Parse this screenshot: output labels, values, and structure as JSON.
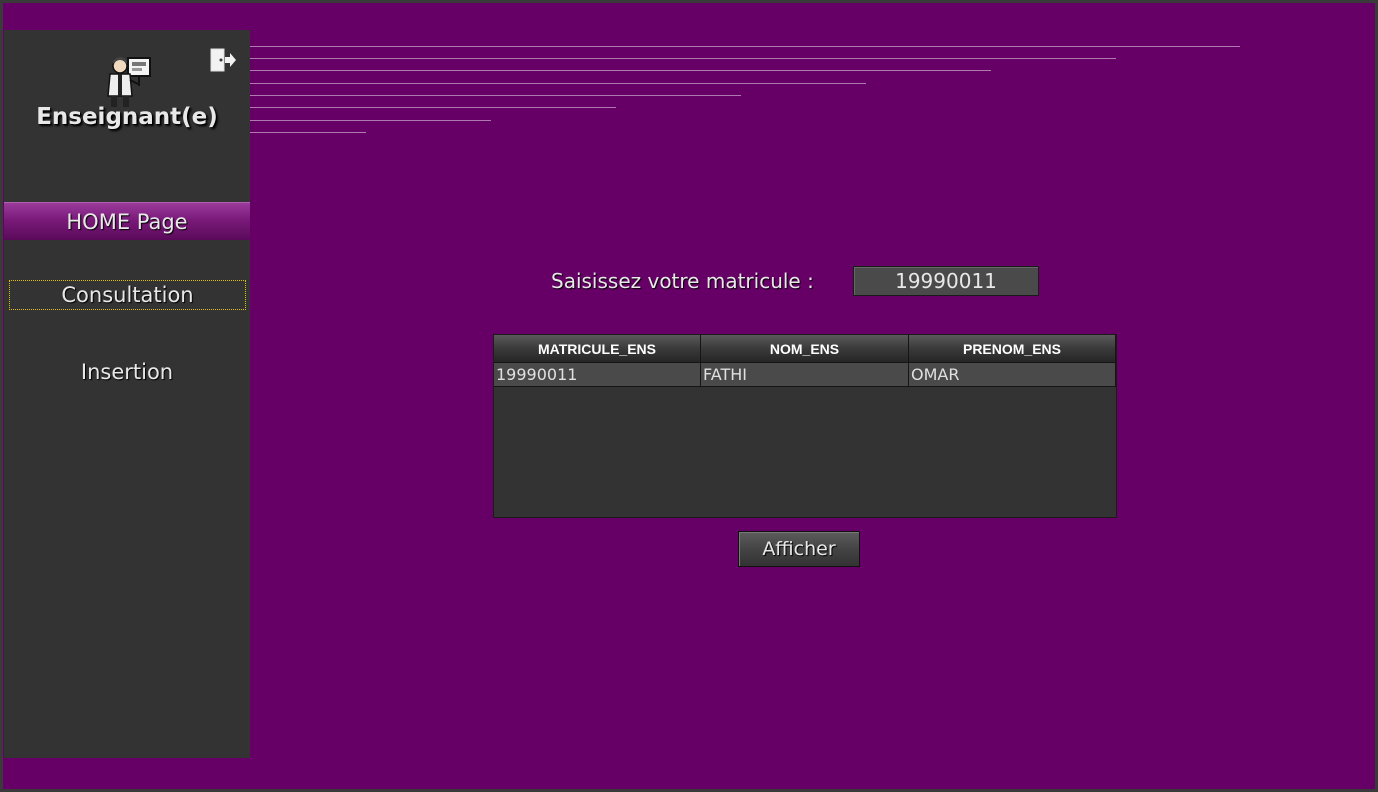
{
  "sidebar": {
    "role_title": "Enseignant(e)",
    "nav": {
      "home": "HOME Page",
      "consultation": "Consultation",
      "insertion": "Insertion"
    }
  },
  "search": {
    "label": "Saisissez votre matricule :",
    "value": "19990011"
  },
  "table": {
    "columns": [
      "MATRICULE_ENS",
      "NOM_ENS",
      "PRENOM_ENS"
    ],
    "rows": [
      [
        "19990011",
        "FATHI",
        "OMAR"
      ]
    ]
  },
  "actions": {
    "afficher_label": "Afficher"
  },
  "colors": {
    "background": "#660066",
    "sidebar": "#333333",
    "accent": "#7a1a7a"
  }
}
